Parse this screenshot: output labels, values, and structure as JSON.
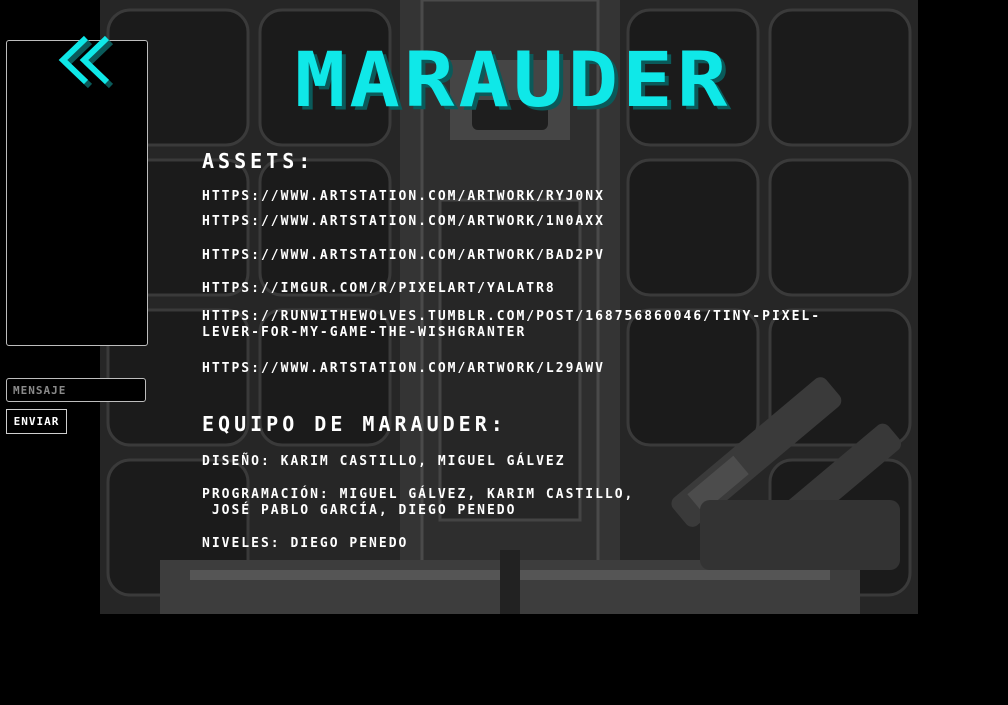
{
  "game": {
    "title": "MARAUDER"
  },
  "chat": {
    "back_icon": "double-chevron-left-icon",
    "input_placeholder": "MENSAJE",
    "send_label": "ENVIAR"
  },
  "assets": {
    "heading": "ASSETS:",
    "links": [
      "HTTPS://WWW.ARTSTATION.COM/ARTWORK/RYJ0NX",
      "HTTPS://WWW.ARTSTATION.COM/ARTWORK/1N0AXX",
      "HTTPS://WWW.ARTSTATION.COM/ARTWORK/BAD2PV",
      "HTTPS://IMGUR.COM/R/PIXELART/YALATR8",
      "HTTPS://RUNWITHEWOLVES.TUMBLR.COM/POST/168756860046/TINY-PIXEL-LEVER-FOR-MY-GAME-THE-WISHGRANTER",
      "HTTPS://WWW.ARTSTATION.COM/ARTWORK/L29AWV"
    ]
  },
  "team": {
    "heading": "EQUIPO DE MARAUDER:",
    "design": "DISEÑO: KARIM CASTILLO, MIGUEL GÁLVEZ",
    "programming_line1": "PROGRAMACIÓN: MIGUEL GÁLVEZ, KARIM CASTILLO,",
    "programming_line2": " JOSÉ PABLO GARCÍA, DIEGO PENEDO",
    "levels": "NIVELES: DIEGO PENEDO"
  },
  "colors": {
    "title": "#0fe8e8",
    "title_shadow": "#0a5a5a",
    "text": "#ffffff",
    "page_bg": "#000000",
    "panel_bg": "#2a2a2a"
  }
}
